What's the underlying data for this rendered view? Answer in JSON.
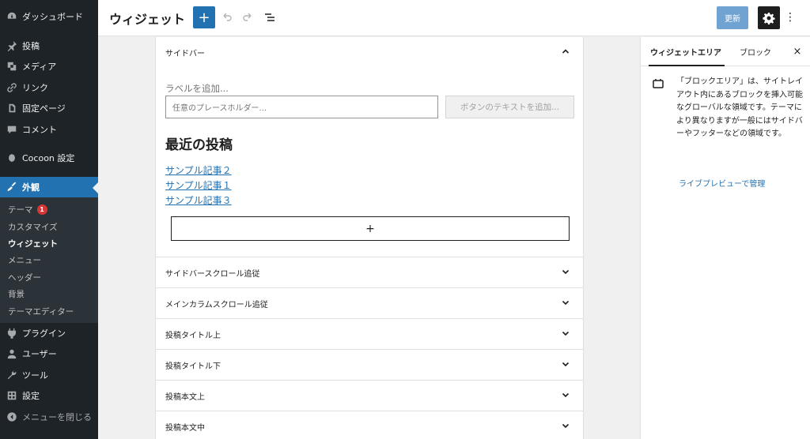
{
  "admin_menu": {
    "items": [
      {
        "label": "ダッシュボード",
        "icon": "dashboard-icon"
      },
      {
        "label": "投稿",
        "icon": "pin-icon"
      },
      {
        "label": "メディア",
        "icon": "media-icon"
      },
      {
        "label": "リンク",
        "icon": "link-icon"
      },
      {
        "label": "固定ページ",
        "icon": "page-icon"
      },
      {
        "label": "コメント",
        "icon": "comment-icon"
      },
      {
        "label": "Cocoon 設定",
        "icon": "cocoon-icon"
      },
      {
        "label": "外観",
        "icon": "appearance-icon"
      }
    ],
    "appearance_sub": [
      {
        "label": "テーマ",
        "badge": "1"
      },
      {
        "label": "カスタマイズ"
      },
      {
        "label": "ウィジェット"
      },
      {
        "label": "メニュー"
      },
      {
        "label": "ヘッダー"
      },
      {
        "label": "背景"
      },
      {
        "label": "テーマエディター"
      }
    ],
    "after_items": [
      {
        "label": "プラグイン",
        "icon": "plugin-icon"
      },
      {
        "label": "ユーザー",
        "icon": "user-icon"
      },
      {
        "label": "ツール",
        "icon": "wrench-icon"
      },
      {
        "label": "設定",
        "icon": "settings-icon"
      }
    ],
    "collapse_label": "メニューを閉じる"
  },
  "header": {
    "title": "ウィジェット",
    "add_label": "+",
    "update_label": "更新",
    "more_label": "⋮"
  },
  "canvas": {
    "open_area_title": "サイドバー",
    "search": {
      "label": "ラベルを追加...",
      "placeholder": "任意のプレースホルダー...",
      "button": "ボタンのテキストを追加..."
    },
    "recent_title": "最近の投稿",
    "recent_posts": [
      "サンプル記事２",
      "サンプル記事１",
      "サンプル記事３"
    ],
    "appender": "+",
    "areas": [
      "サイドバースクロール追従",
      "メインカラムスクロール追従",
      "投稿タイトル上",
      "投稿タイトル下",
      "投稿本文上",
      "投稿本文中"
    ]
  },
  "settings_sidebar": {
    "tab_widget_area": "ウィジェットエリア",
    "tab_block": "ブロック",
    "close": "×",
    "description": "「ブロックエリア」は、サイトレイアウト内にあるブロックを挿入可能なグローバルな領域です。テーマにより異なりますが一般にはサイドバーやフッターなどの領域です。",
    "link": "ライブプレビューで管理"
  },
  "colors": {
    "accent": "#2271b1",
    "admin_bg": "#1d2327",
    "badge": "#d63638"
  }
}
